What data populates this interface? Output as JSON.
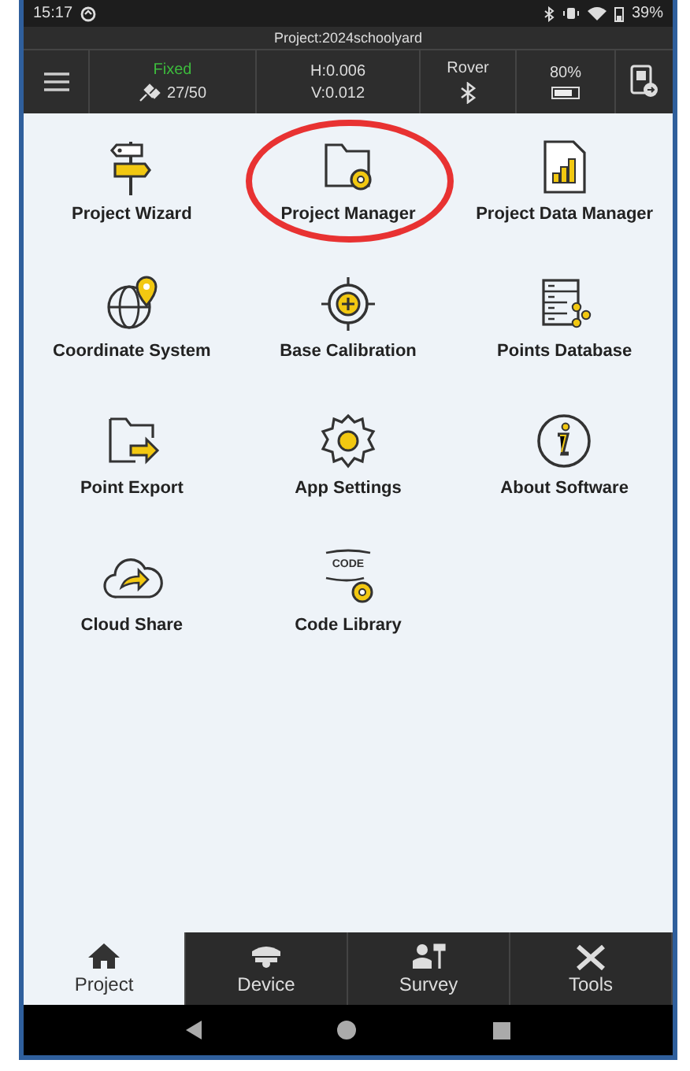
{
  "status_bar": {
    "time": "15:17",
    "battery": "39%"
  },
  "project_title": "Project:2024schoolyard",
  "info_bar": {
    "fix_status": "Fixed",
    "satellites": "27/50",
    "h_precision": "H:0.006",
    "v_precision": "V:0.012",
    "mode": "Rover",
    "battery_percent": "80%"
  },
  "menu_items": [
    {
      "label": "Project Wizard",
      "circled": false
    },
    {
      "label": "Project Manager",
      "circled": true
    },
    {
      "label": "Project Data Manager",
      "circled": false
    },
    {
      "label": "Coordinate System",
      "circled": false
    },
    {
      "label": "Base Calibration",
      "circled": false
    },
    {
      "label": "Points Database",
      "circled": false
    },
    {
      "label": "Point Export",
      "circled": false
    },
    {
      "label": "App Settings",
      "circled": false
    },
    {
      "label": "About Software",
      "circled": false
    },
    {
      "label": "Cloud Share",
      "circled": false
    },
    {
      "label": "Code Library",
      "circled": false
    }
  ],
  "code_badge": "CODE",
  "bottom_tabs": [
    {
      "label": "Project",
      "selected": true
    },
    {
      "label": "Device",
      "selected": false
    },
    {
      "label": "Survey",
      "selected": false
    },
    {
      "label": "Tools",
      "selected": false
    }
  ]
}
